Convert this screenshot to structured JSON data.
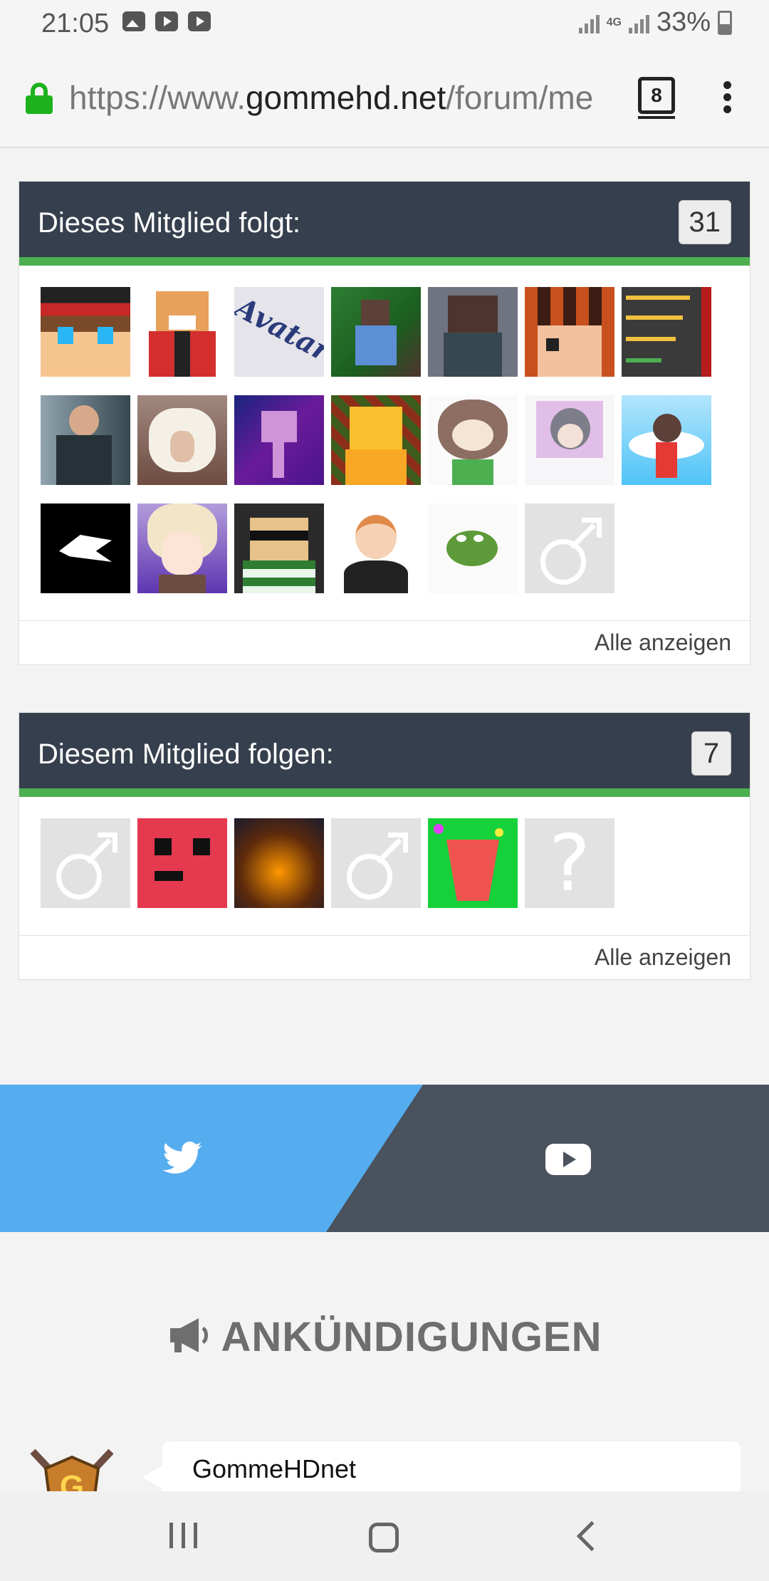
{
  "status_bar": {
    "time": "21:05",
    "notification_icons": [
      "image-icon",
      "youtube-icon",
      "youtube-icon"
    ],
    "network": "4G",
    "battery": "33%"
  },
  "browser": {
    "url_prefix": "https://www.",
    "url_domain": "gommehd.net",
    "url_rest": "/forum/me",
    "tab_count": "8",
    "secure": true
  },
  "following": {
    "title": "Dieses Mitglied folgt:",
    "count": "31",
    "footer_link": "Alle anzeigen",
    "avatars": [
      "minecraft-skin-red-cap",
      "minecraft-fox-red-jacket",
      "avatar-placeholder",
      "minecraft-character-forest",
      "minecraft-bear-hoodie",
      "minecraft-pixel-face",
      "cookie-clicker-stats",
      "man-in-suit-photo",
      "sheep-photo",
      "purple-enderman",
      "yellow-minecraft-character",
      "tom-nook",
      "anime-hooded-character",
      "angel-character-sky",
      "white-wolf-logo",
      "anime-white-hair",
      "minecraft-sunglasses",
      "cartoon-boy",
      "pepe-frog",
      "male-placeholder"
    ]
  },
  "followers": {
    "title": "Diesem Mitglied folgen:",
    "count": "7",
    "footer_link": "Alle anzeigen",
    "avatars": [
      "male-placeholder",
      "red-slime-face",
      "fire-scene",
      "male-placeholder",
      "party-cup-green",
      "unknown-placeholder"
    ]
  },
  "social": {
    "left": "twitter-icon",
    "right": "youtube-icon"
  },
  "announcements": {
    "heading": "ANKÜNDIGUNGEN",
    "items": [
      {
        "author": "GommeHDnet"
      }
    ]
  },
  "colors": {
    "header_bg": "#363f4d",
    "accent_green": "#4caf50",
    "twitter_blue": "#55acee",
    "youtube_bg": "#4a525d",
    "lock_green": "#1db21d"
  }
}
